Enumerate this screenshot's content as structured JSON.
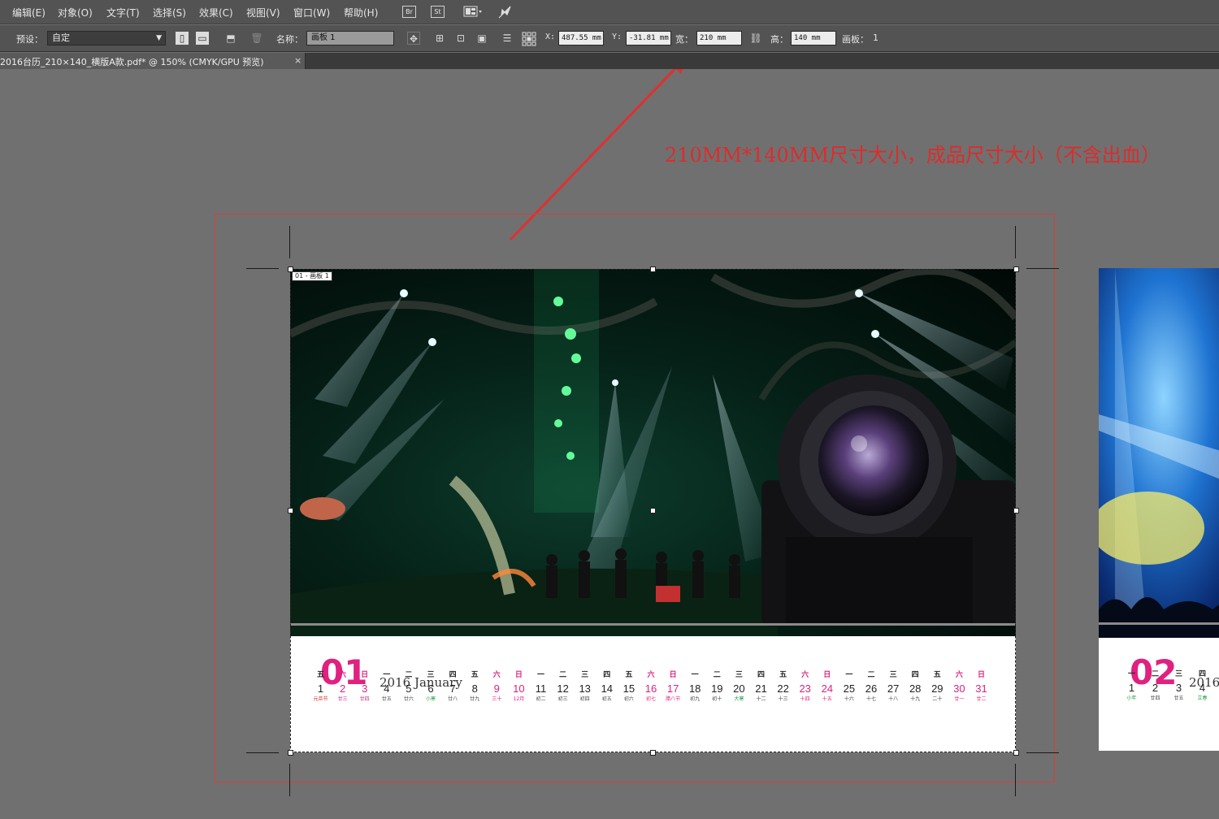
{
  "menubar": {
    "items": [
      "编辑(E)",
      "对象(O)",
      "文字(T)",
      "选择(S)",
      "效果(C)",
      "视图(V)",
      "窗口(W)",
      "帮助(H)"
    ],
    "bridge_label": "Br",
    "stock_label": "St"
  },
  "controlbar": {
    "preset_label": "预设：",
    "preset_value": "自定",
    "name_label": "名称：",
    "name_value": "画板 1",
    "x_label": "X:",
    "x_value": "487.55 mm",
    "y_label": "Y:",
    "y_value": "-31.81 mm",
    "w_label": "宽：",
    "w_value": "210 mm",
    "h_label": "高：",
    "h_value": "140 mm",
    "artboard_label": "画板：",
    "artboard_value": "1"
  },
  "document_tab": {
    "title": "2016台历_210×140_横版A款.pdf* @ 150% (CMYK/GPU 预览)",
    "close": "×"
  },
  "annotation": {
    "text": "210MM*140MM尺寸大小，成品尺寸大小（不含出血）",
    "color": "#e02a2a"
  },
  "artboard": {
    "label": "01 - 画板 1",
    "month_number": "01",
    "month_title": "2016 January",
    "days": [
      {
        "wd": "五",
        "d": "1",
        "lunar": "元旦节",
        "style": "red"
      },
      {
        "wd": "六",
        "d": "2",
        "lunar": "廿三",
        "style": "pink"
      },
      {
        "wd": "日",
        "d": "3",
        "lunar": "廿四",
        "style": "pink"
      },
      {
        "wd": "一",
        "d": "4",
        "lunar": "廿五",
        "style": ""
      },
      {
        "wd": "二",
        "d": "5",
        "lunar": "廿六",
        "style": ""
      },
      {
        "wd": "三",
        "d": "6",
        "lunar": "小寒",
        "style": "green"
      },
      {
        "wd": "四",
        "d": "7",
        "lunar": "廿八",
        "style": ""
      },
      {
        "wd": "五",
        "d": "8",
        "lunar": "廿九",
        "style": ""
      },
      {
        "wd": "六",
        "d": "9",
        "lunar": "三十",
        "style": "pink"
      },
      {
        "wd": "日",
        "d": "10",
        "lunar": "12月",
        "style": "pink"
      },
      {
        "wd": "一",
        "d": "11",
        "lunar": "初二",
        "style": ""
      },
      {
        "wd": "二",
        "d": "12",
        "lunar": "初三",
        "style": ""
      },
      {
        "wd": "三",
        "d": "13",
        "lunar": "初四",
        "style": ""
      },
      {
        "wd": "四",
        "d": "14",
        "lunar": "初五",
        "style": ""
      },
      {
        "wd": "五",
        "d": "15",
        "lunar": "初六",
        "style": ""
      },
      {
        "wd": "六",
        "d": "16",
        "lunar": "初七",
        "style": "pink"
      },
      {
        "wd": "日",
        "d": "17",
        "lunar": "腊八节",
        "style": "pink"
      },
      {
        "wd": "一",
        "d": "18",
        "lunar": "初九",
        "style": ""
      },
      {
        "wd": "二",
        "d": "19",
        "lunar": "初十",
        "style": ""
      },
      {
        "wd": "三",
        "d": "20",
        "lunar": "大寒",
        "style": "green"
      },
      {
        "wd": "四",
        "d": "21",
        "lunar": "十二",
        "style": ""
      },
      {
        "wd": "五",
        "d": "22",
        "lunar": "十三",
        "style": ""
      },
      {
        "wd": "六",
        "d": "23",
        "lunar": "十四",
        "style": "pink"
      },
      {
        "wd": "日",
        "d": "24",
        "lunar": "十五",
        "style": "pink"
      },
      {
        "wd": "一",
        "d": "25",
        "lunar": "十六",
        "style": ""
      },
      {
        "wd": "二",
        "d": "26",
        "lunar": "十七",
        "style": ""
      },
      {
        "wd": "三",
        "d": "27",
        "lunar": "十八",
        "style": ""
      },
      {
        "wd": "四",
        "d": "28",
        "lunar": "十九",
        "style": ""
      },
      {
        "wd": "五",
        "d": "29",
        "lunar": "二十",
        "style": ""
      },
      {
        "wd": "六",
        "d": "30",
        "lunar": "廿一",
        "style": "pink"
      },
      {
        "wd": "日",
        "d": "31",
        "lunar": "廿二",
        "style": "pink"
      }
    ]
  },
  "artboard2": {
    "month_number": "02",
    "month_title": "2016",
    "days": [
      {
        "wd": "一",
        "d": "1",
        "lunar": "小年",
        "style": "green"
      },
      {
        "wd": "二",
        "d": "2",
        "lunar": "廿四",
        "style": ""
      },
      {
        "wd": "三",
        "d": "3",
        "lunar": "廿五",
        "style": ""
      },
      {
        "wd": "四",
        "d": "4",
        "lunar": "立春",
        "style": "green"
      }
    ]
  }
}
